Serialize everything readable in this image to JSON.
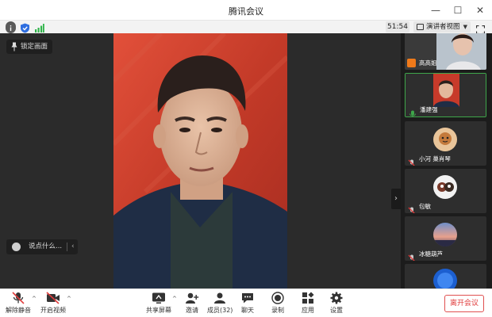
{
  "window": {
    "title": "腾讯会议",
    "controls": [
      "minimize",
      "maximize",
      "close"
    ]
  },
  "infobar": {
    "timer": "51:54",
    "view_label": "演讲者视图"
  },
  "main": {
    "lock_label": "锁定画面",
    "chat_placeholder": "说点什么..."
  },
  "participants": [
    {
      "name": "高高姐",
      "active": false
    },
    {
      "name": "潘建强",
      "active": true
    },
    {
      "name": "小河 巢肖琴",
      "active": false
    },
    {
      "name": "包敏",
      "active": false
    },
    {
      "name": "冰糖葫芦",
      "active": false
    }
  ],
  "toolbar": {
    "unmute_label": "解除静音",
    "video_label": "开启视频",
    "share_label": "共享屏幕",
    "invite_label": "邀请",
    "members_label": "成员(32)",
    "chat_label": "聊天",
    "record_label": "录制",
    "apps_label": "应用",
    "settings_label": "设置",
    "leave_label": "离开会议"
  },
  "colors": {
    "accent_green": "#3ea64a",
    "leave_red": "#e03c3c",
    "bg_dark": "#2b2b2b"
  }
}
